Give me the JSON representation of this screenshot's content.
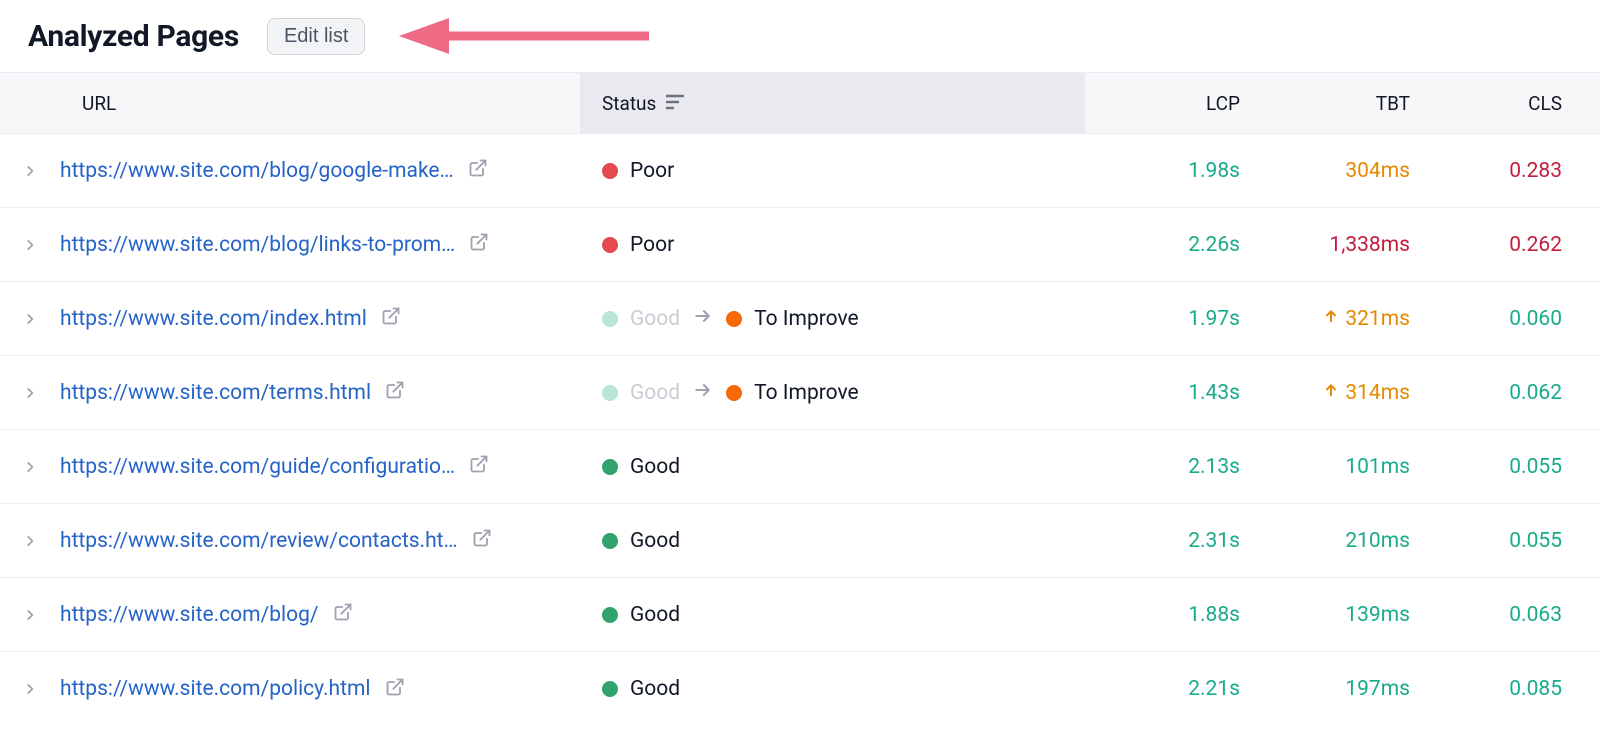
{
  "header": {
    "title": "Analyzed Pages",
    "edit_button": "Edit list"
  },
  "columns": {
    "url": "URL",
    "status": "Status",
    "lcp": "LCP",
    "tbt": "TBT",
    "cls": "CLS"
  },
  "status_colors": {
    "poor": "#e5484d",
    "good": "#30a46c",
    "good_faded": "#b9e6d5",
    "to_improve": "#f76808"
  },
  "rows": [
    {
      "url": "https://www.site.com/blog/google-make…",
      "status": {
        "type": "single",
        "label": "Poor",
        "dot": "red"
      },
      "lcp": {
        "text": "1.98s",
        "tone": "teal"
      },
      "tbt": {
        "text": "304ms",
        "tone": "amber",
        "trend": "none"
      },
      "cls": {
        "text": "0.283",
        "tone": "crimson"
      }
    },
    {
      "url": "https://www.site.com/blog/links-to-prom…",
      "status": {
        "type": "single",
        "label": "Poor",
        "dot": "red"
      },
      "lcp": {
        "text": "2.26s",
        "tone": "teal"
      },
      "tbt": {
        "text": "1,338ms",
        "tone": "crimson",
        "trend": "none"
      },
      "cls": {
        "text": "0.262",
        "tone": "crimson"
      }
    },
    {
      "url": "https://www.site.com/index.html",
      "status": {
        "type": "transition",
        "from_label": "Good",
        "to_label": "To Improve"
      },
      "lcp": {
        "text": "1.97s",
        "tone": "teal"
      },
      "tbt": {
        "text": "321ms",
        "tone": "orange",
        "trend": "up"
      },
      "cls": {
        "text": "0.060",
        "tone": "teal"
      }
    },
    {
      "url": "https://www.site.com/terms.html",
      "status": {
        "type": "transition",
        "from_label": "Good",
        "to_label": "To Improve"
      },
      "lcp": {
        "text": "1.43s",
        "tone": "teal"
      },
      "tbt": {
        "text": "314ms",
        "tone": "orange",
        "trend": "up"
      },
      "cls": {
        "text": "0.062",
        "tone": "teal"
      }
    },
    {
      "url": "https://www.site.com/guide/configuratio…",
      "status": {
        "type": "single",
        "label": "Good",
        "dot": "green"
      },
      "lcp": {
        "text": "2.13s",
        "tone": "teal"
      },
      "tbt": {
        "text": "101ms",
        "tone": "teal",
        "trend": "none"
      },
      "cls": {
        "text": "0.055",
        "tone": "teal"
      }
    },
    {
      "url": "https://www.site.com/review/contacts.ht…",
      "status": {
        "type": "single",
        "label": "Good",
        "dot": "green"
      },
      "lcp": {
        "text": "2.31s",
        "tone": "teal"
      },
      "tbt": {
        "text": "210ms",
        "tone": "teal",
        "trend": "none"
      },
      "cls": {
        "text": "0.055",
        "tone": "teal"
      }
    },
    {
      "url": "https://www.site.com/blog/",
      "status": {
        "type": "single",
        "label": "Good",
        "dot": "green"
      },
      "lcp": {
        "text": "1.88s",
        "tone": "teal"
      },
      "tbt": {
        "text": "139ms",
        "tone": "teal",
        "trend": "none"
      },
      "cls": {
        "text": "0.063",
        "tone": "teal"
      }
    },
    {
      "url": "https://www.site.com/policy.html",
      "status": {
        "type": "single",
        "label": "Good",
        "dot": "green"
      },
      "lcp": {
        "text": "2.21s",
        "tone": "teal"
      },
      "tbt": {
        "text": "197ms",
        "tone": "teal",
        "trend": "none"
      },
      "cls": {
        "text": "0.085",
        "tone": "teal"
      }
    }
  ]
}
